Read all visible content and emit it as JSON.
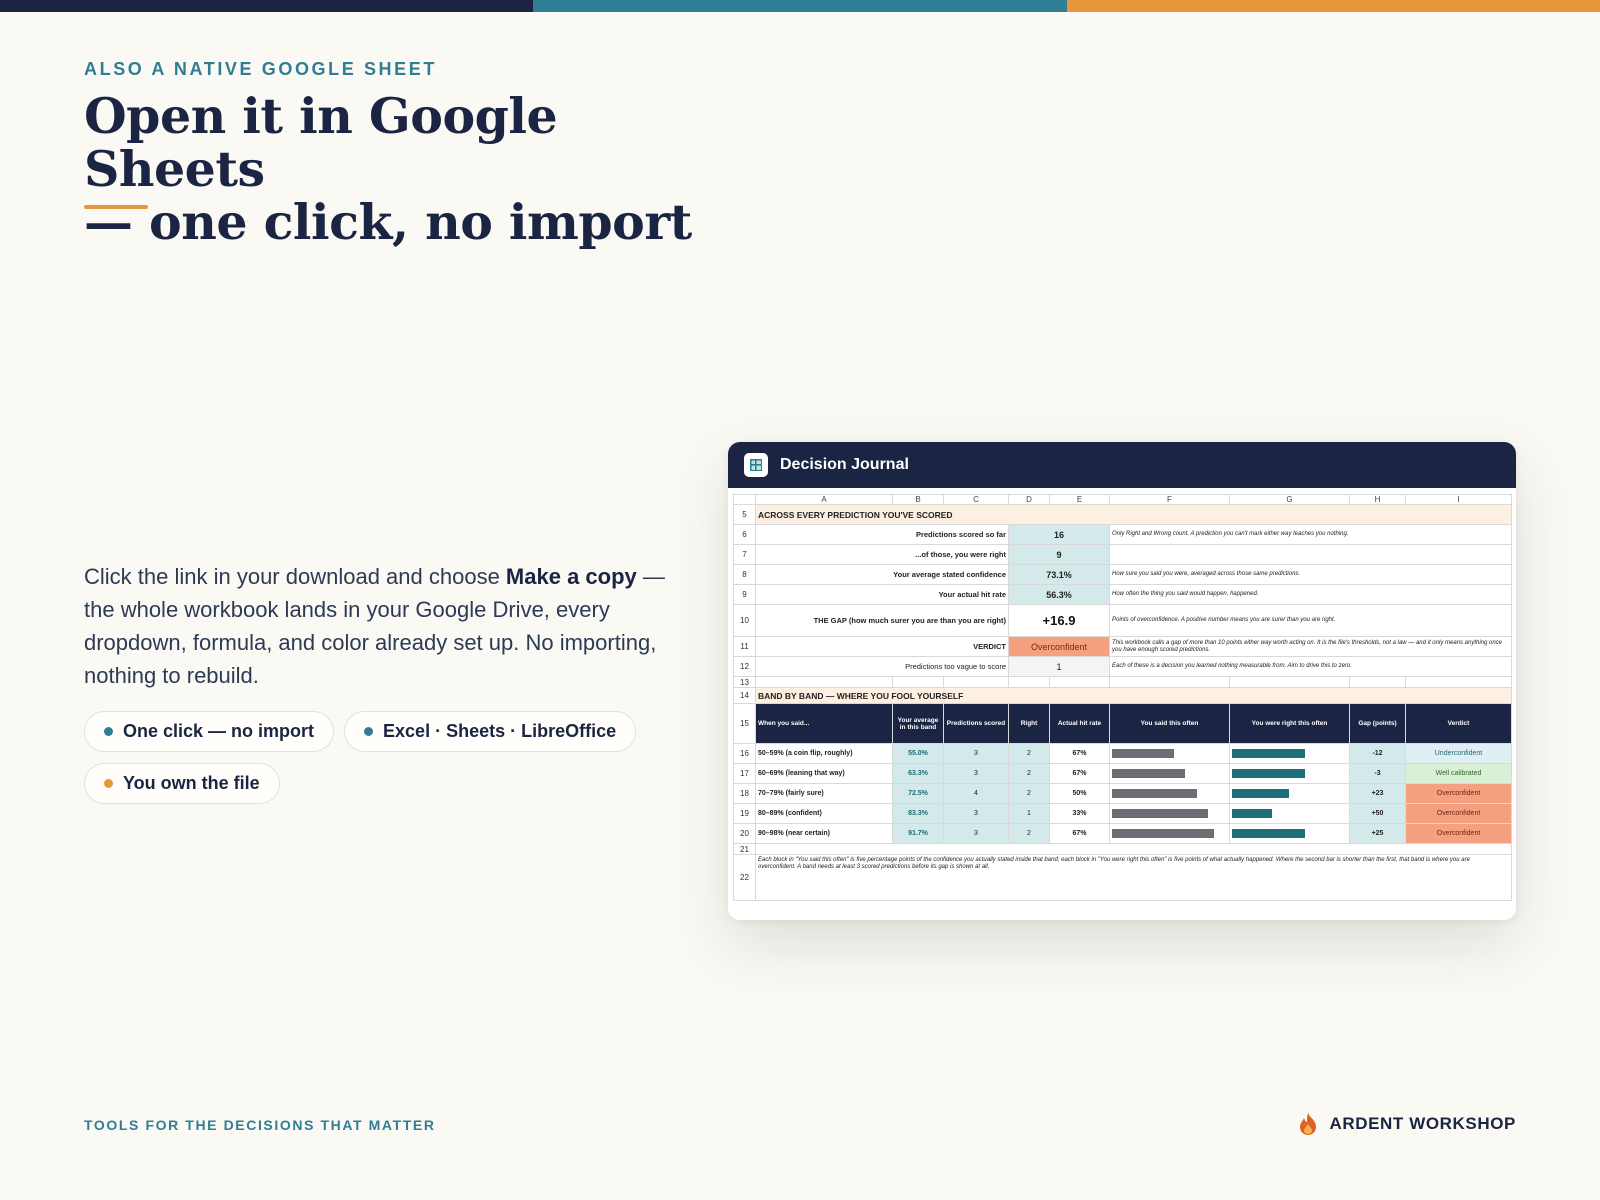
{
  "colors": {
    "navy": "#1b2543",
    "teal": "#2f7e93",
    "orange": "#e8963c",
    "background": "#faf9f4"
  },
  "eyebrow": "ALSO A NATIVE GOOGLE SHEET",
  "headline": {
    "line1": "Open it in Google Sheets",
    "line2": "— one click, no import"
  },
  "body": {
    "pre": "Click the link in your download and choose ",
    "bold": "Make a copy",
    "post": " — the whole workbook lands in your Google Drive, every dropdown, formula, and color already set up. No importing, nothing to rebuild."
  },
  "pills": [
    {
      "label": "One click — no import",
      "dot_color": "#2f7e93"
    },
    {
      "label": "Excel · Sheets · LibreOffice",
      "dot_color": "#2f7e93"
    },
    {
      "label": "You own the file",
      "dot_color": "#e8963c"
    }
  ],
  "sheet": {
    "title": "Decision Journal",
    "icon": "spreadsheet-icon",
    "columns": [
      "A",
      "B",
      "C",
      "D",
      "E",
      "F",
      "G",
      "H",
      "I"
    ],
    "section1": {
      "row": "5",
      "title": "ACROSS EVERY PREDICTION YOU'VE SCORED"
    },
    "summary": [
      {
        "row": "6",
        "label": "Predictions scored so far",
        "value": "16",
        "note": "Only Right and Wrong count. A prediction you can't mark either way teaches you nothing."
      },
      {
        "row": "7",
        "label": "...of those, you were right",
        "value": "9",
        "note": ""
      },
      {
        "row": "8",
        "label": "Your average stated confidence",
        "value": "73.1%",
        "note": "How sure you said you were, averaged across those same predictions."
      },
      {
        "row": "9",
        "label": "Your actual hit rate",
        "value": "56.3%",
        "note": "How often the thing you said would happen, happened."
      }
    ],
    "gap": {
      "row": "10",
      "label": "THE GAP  (how much surer you are than you are right)",
      "value": "+16.9",
      "note": "Points of overconfidence. A positive number means you are surer than you are right."
    },
    "verdict": {
      "row": "11",
      "label": "VERDICT",
      "value": "Overconfident",
      "note": "This workbook calls a gap of more than 10 points either way worth acting on. It is the file's thresholds, not a law — and it only means anything once you have enough scored predictions."
    },
    "vague": {
      "row": "12",
      "label": "Predictions too vague to score",
      "value": "1",
      "note": "Each of these is a decision you learned nothing measurable from. Aim to drive this to zero."
    },
    "blank_rows": [
      "13",
      "21"
    ],
    "section2": {
      "row": "14",
      "title": "BAND BY BAND — WHERE YOU FOOL YOURSELF"
    },
    "band_header": {
      "row": "15",
      "cols": [
        "When you said...",
        "Your average in this band",
        "Predictions scored",
        "Right",
        "Actual hit rate",
        "You said this often",
        "You were right this often",
        "Gap (points)",
        "Verdict"
      ]
    },
    "bands": [
      {
        "row": "16",
        "name": "50–59%  (a coin flip, roughly)",
        "avg": "55.0%",
        "scored": "3",
        "right": "2",
        "rate": "67%",
        "said_pct": 55.0,
        "right_pct": 67,
        "gap": "-12",
        "verdict": "Underconfident",
        "kind": "under"
      },
      {
        "row": "17",
        "name": "60–69%  (leaning that way)",
        "avg": "63.3%",
        "scored": "3",
        "right": "2",
        "rate": "67%",
        "said_pct": 63.3,
        "right_pct": 67,
        "gap": "-3",
        "verdict": "Well calibrated",
        "kind": "well"
      },
      {
        "row": "18",
        "name": "70–79%  (fairly sure)",
        "avg": "72.5%",
        "scored": "4",
        "right": "2",
        "rate": "50%",
        "said_pct": 72.5,
        "right_pct": 50,
        "gap": "+23",
        "verdict": "Overconfident",
        "kind": "over"
      },
      {
        "row": "19",
        "name": "80–89%  (confident)",
        "avg": "83.3%",
        "scored": "3",
        "right": "1",
        "rate": "33%",
        "said_pct": 83.3,
        "right_pct": 33,
        "gap": "+50",
        "verdict": "Overconfident",
        "kind": "over"
      },
      {
        "row": "20",
        "name": "90–98%  (near certain)",
        "avg": "91.7%",
        "scored": "3",
        "right": "2",
        "rate": "67%",
        "said_pct": 91.7,
        "right_pct": 67,
        "gap": "+25",
        "verdict": "Overconfident",
        "kind": "over"
      }
    ],
    "footnote": {
      "row": "22",
      "text": "Each block in \"You said this often\" is five percentage points of the confidence you actually stated inside that band; each block in \"You were right this often\" is five points of what actually happened. Where the second bar is shorter than the first, that band is where you are overconfident. A band needs at least 3 scored predictions before its gap is shown at all."
    }
  },
  "footer": {
    "tagline": "TOOLS FOR THE DECISIONS THAT MATTER",
    "brand": "ARDENT WORKSHOP",
    "brand_icon": "flame-icon"
  }
}
